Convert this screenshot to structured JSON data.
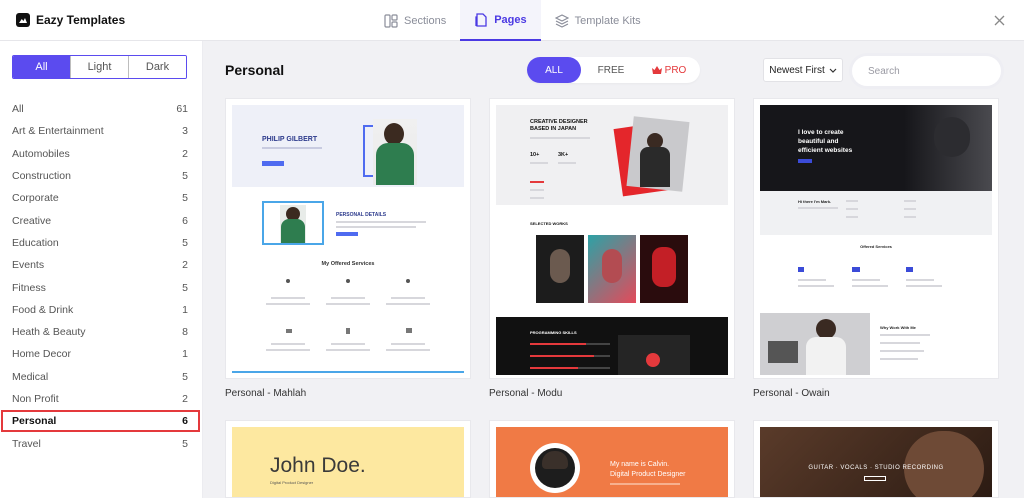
{
  "header": {
    "brand": "Eazy Templates",
    "tabs": [
      {
        "label": "Sections",
        "icon": "sections-icon"
      },
      {
        "label": "Pages",
        "icon": "pages-icon"
      },
      {
        "label": "Template Kits",
        "icon": "template-kits-icon"
      }
    ],
    "active_tab": "Pages"
  },
  "sidebar": {
    "theme_options": [
      "All",
      "Light",
      "Dark"
    ],
    "active_theme": "All",
    "categories": [
      {
        "label": "All",
        "count": "61"
      },
      {
        "label": "Art & Entertainment",
        "count": "3"
      },
      {
        "label": "Automobiles",
        "count": "2"
      },
      {
        "label": "Construction",
        "count": "5"
      },
      {
        "label": "Corporate",
        "count": "5"
      },
      {
        "label": "Creative",
        "count": "6"
      },
      {
        "label": "Education",
        "count": "5"
      },
      {
        "label": "Events",
        "count": "2"
      },
      {
        "label": "Fitness",
        "count": "5"
      },
      {
        "label": "Food & Drink",
        "count": "1"
      },
      {
        "label": "Heath & Beauty",
        "count": "8"
      },
      {
        "label": "Home Decor",
        "count": "1"
      },
      {
        "label": "Medical",
        "count": "5"
      },
      {
        "label": "Non Profit",
        "count": "2"
      },
      {
        "label": "Personal",
        "count": "6"
      },
      {
        "label": "Travel",
        "count": "5"
      }
    ],
    "active_category": "Personal"
  },
  "main": {
    "title": "Personal",
    "filters": {
      "all": "ALL",
      "free": "FREE",
      "pro": "PRO"
    },
    "sort_label": "Newest First",
    "search_placeholder": "Search",
    "cards": [
      {
        "label": "Personal - Mahlah",
        "thumb": {
          "hero_name": "PHILIP GILBERT",
          "details_heading": "PERSONAL DETAILS",
          "services_heading": "My Offered Services"
        }
      },
      {
        "label": "Personal - Modu",
        "thumb": {
          "hero_line1": "CREATIVE DESIGNER",
          "hero_line2": "BASED IN JAPAN",
          "stat1": "10+",
          "stat2": "3K+",
          "works_heading": "SELECTED WORKS",
          "skills_heading": "PROGRAMMING SKILLS"
        }
      },
      {
        "label": "Personal - Owain",
        "thumb": {
          "hero_line1": "I love to create",
          "hero_line2": "beautiful and",
          "hero_line3": "efficient websites",
          "about_heading": "Hi there I'm Mark.",
          "services_heading": "Offered Services",
          "why_heading": "Why Work With Me"
        }
      },
      {
        "label": "",
        "thumb": {
          "name": "John Doe.",
          "subtitle": "Digital Product Designer"
        }
      },
      {
        "label": "",
        "thumb": {
          "line1": "My name is Calvin.",
          "line2": "Digital Product Designer"
        }
      },
      {
        "label": "",
        "thumb": {
          "headline": "GUITAR · VOCALS · STUDIO RECORDING"
        }
      }
    ]
  },
  "colors": {
    "accent": "#5b4bef",
    "highlight": "#e4393c",
    "pro": "#e4393c"
  }
}
